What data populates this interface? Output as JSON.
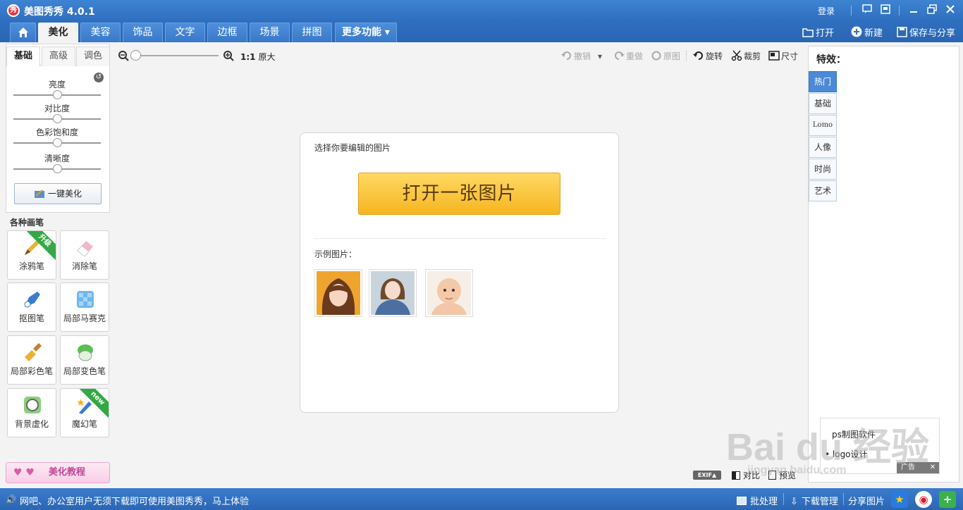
{
  "app": {
    "title": "美图秀秀 4.0.1",
    "logo_text": "秀",
    "login": "登录"
  },
  "tabs": [
    {
      "label": "⌂",
      "name": "home"
    },
    {
      "label": "美化",
      "name": "beautify"
    },
    {
      "label": "美容",
      "name": "cosmetic"
    },
    {
      "label": "饰品",
      "name": "accessories"
    },
    {
      "label": "文字",
      "name": "text"
    },
    {
      "label": "边框",
      "name": "border"
    },
    {
      "label": "场景",
      "name": "scene"
    },
    {
      "label": "拼图",
      "name": "collage"
    },
    {
      "label": "更多功能 ▾",
      "name": "more"
    }
  ],
  "top_actions": {
    "open": "打开",
    "new": "新建",
    "save_share": "保存与分享"
  },
  "left": {
    "subtabs": [
      "基础",
      "高级",
      "调色"
    ],
    "sliders": [
      {
        "label": "亮度",
        "value": 0.5
      },
      {
        "label": "对比度",
        "value": 0.5
      },
      {
        "label": "色彩饱和度",
        "value": 0.5
      },
      {
        "label": "清晰度",
        "value": 0.5
      }
    ],
    "one_key": "一键美化",
    "brushes_title": "各种画笔",
    "brushes": [
      {
        "label": "涂鸦笔",
        "ribbon": "升级"
      },
      {
        "label": "消除笔",
        "ribbon": ""
      },
      {
        "label": "抠图笔",
        "ribbon": ""
      },
      {
        "label": "局部马赛克",
        "ribbon": ""
      },
      {
        "label": "局部彩色笔",
        "ribbon": ""
      },
      {
        "label": "局部变色笔",
        "ribbon": ""
      },
      {
        "label": "背景虚化",
        "ribbon": ""
      },
      {
        "label": "魔幻笔",
        "ribbon": "new"
      }
    ],
    "tutorial": "美化教程"
  },
  "toolbar": {
    "ratio_bold": "1:1",
    "ratio": "原大",
    "undo": "撤销",
    "redo": "重做",
    "original": "原图",
    "rotate": "旋转",
    "crop": "裁剪",
    "size": "尺寸"
  },
  "main": {
    "select_title": "选择你要编辑的图片",
    "open_button": "打开一张图片",
    "samples_title": "示例图片："
  },
  "right": {
    "fx_title": "特效：",
    "categories": [
      "热门",
      "基础",
      "Lomo",
      "人像",
      "时尚",
      "艺术"
    ],
    "ad_line1": "ps制图软件",
    "ad_line2": "• logo设计",
    "ad_tag": "广告"
  },
  "bottom": {
    "exif": "EXIF▲",
    "compare": "对比",
    "preview": "预览"
  },
  "status": {
    "message": "网吧、办公室用户无须下载即可使用美图秀秀，马上体验",
    "batch": "批处理",
    "download": "下载管理",
    "share": "分享图片"
  },
  "watermark": {
    "brand": "Bai du 经验",
    "url": "jingyan.baidu.com"
  },
  "colors": {
    "brand_blue": "#2f6fc0",
    "open_button": "#f5b521",
    "accent_green": "#33a845"
  }
}
